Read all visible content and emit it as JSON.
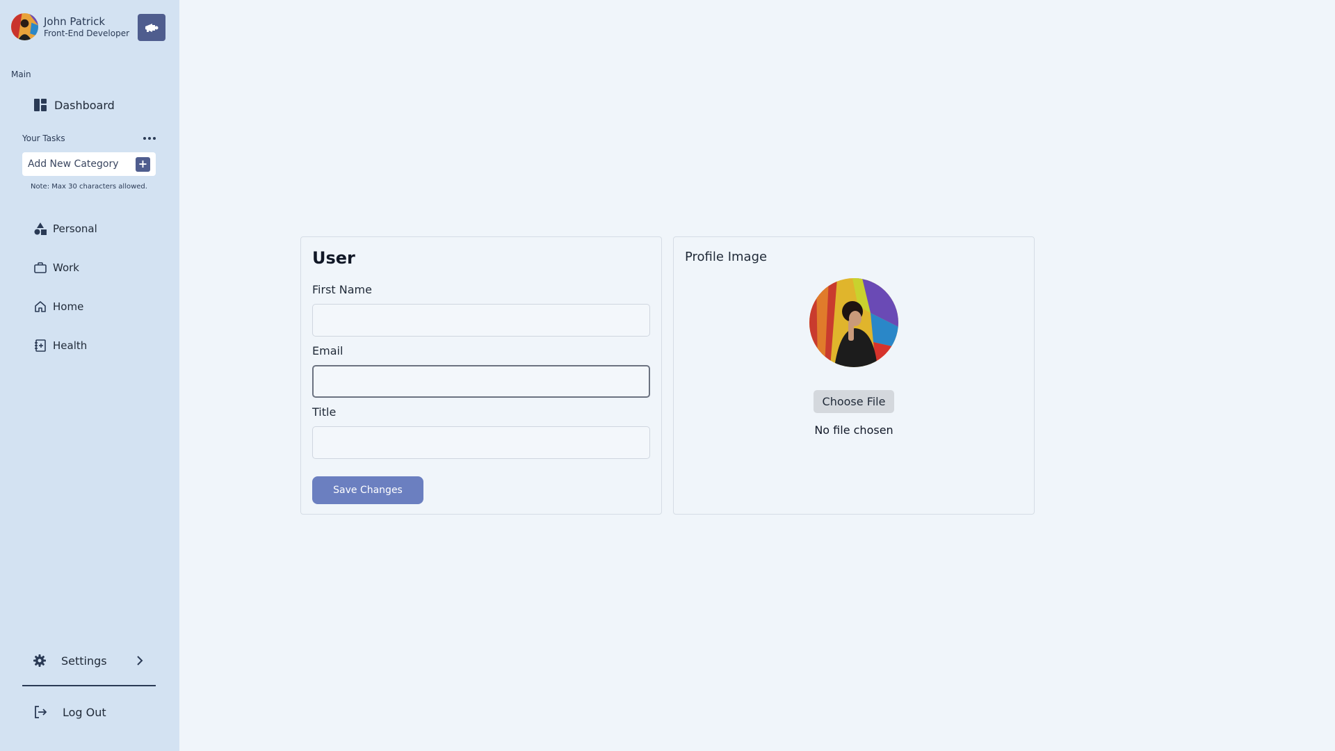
{
  "sidebar": {
    "user": {
      "name": "John Patrick",
      "role": "Front-End Developer"
    },
    "section_main": "Main",
    "dashboard_label": "Dashboard",
    "tasks_label": "Your Tasks",
    "add_category_label": "Add New Category",
    "add_category_icon": "+",
    "note": "Note: Max 30 characters allowed.",
    "categories": [
      {
        "label": "Personal",
        "icon": "shapes-icon"
      },
      {
        "label": "Work",
        "icon": "briefcase-icon"
      },
      {
        "label": "Home",
        "icon": "house-icon"
      },
      {
        "label": "Health",
        "icon": "notebook-plus-icon"
      }
    ],
    "settings_label": "Settings",
    "logout_label": "Log Out"
  },
  "user_form": {
    "title": "User",
    "first_name_label": "First Name",
    "first_name_value": "",
    "email_label": "Email",
    "email_value": "",
    "title_label": "Title",
    "title_value": "",
    "save_label": "Save Changes"
  },
  "profile_image": {
    "title": "Profile Image",
    "choose_label": "Choose File",
    "file_status": "No file chosen"
  },
  "colors": {
    "sidebar_bg": "#d3e2f2",
    "page_bg": "#f0f5fa",
    "accent_dark": "#4f5d8e",
    "accent_button": "#6b7fc0"
  }
}
